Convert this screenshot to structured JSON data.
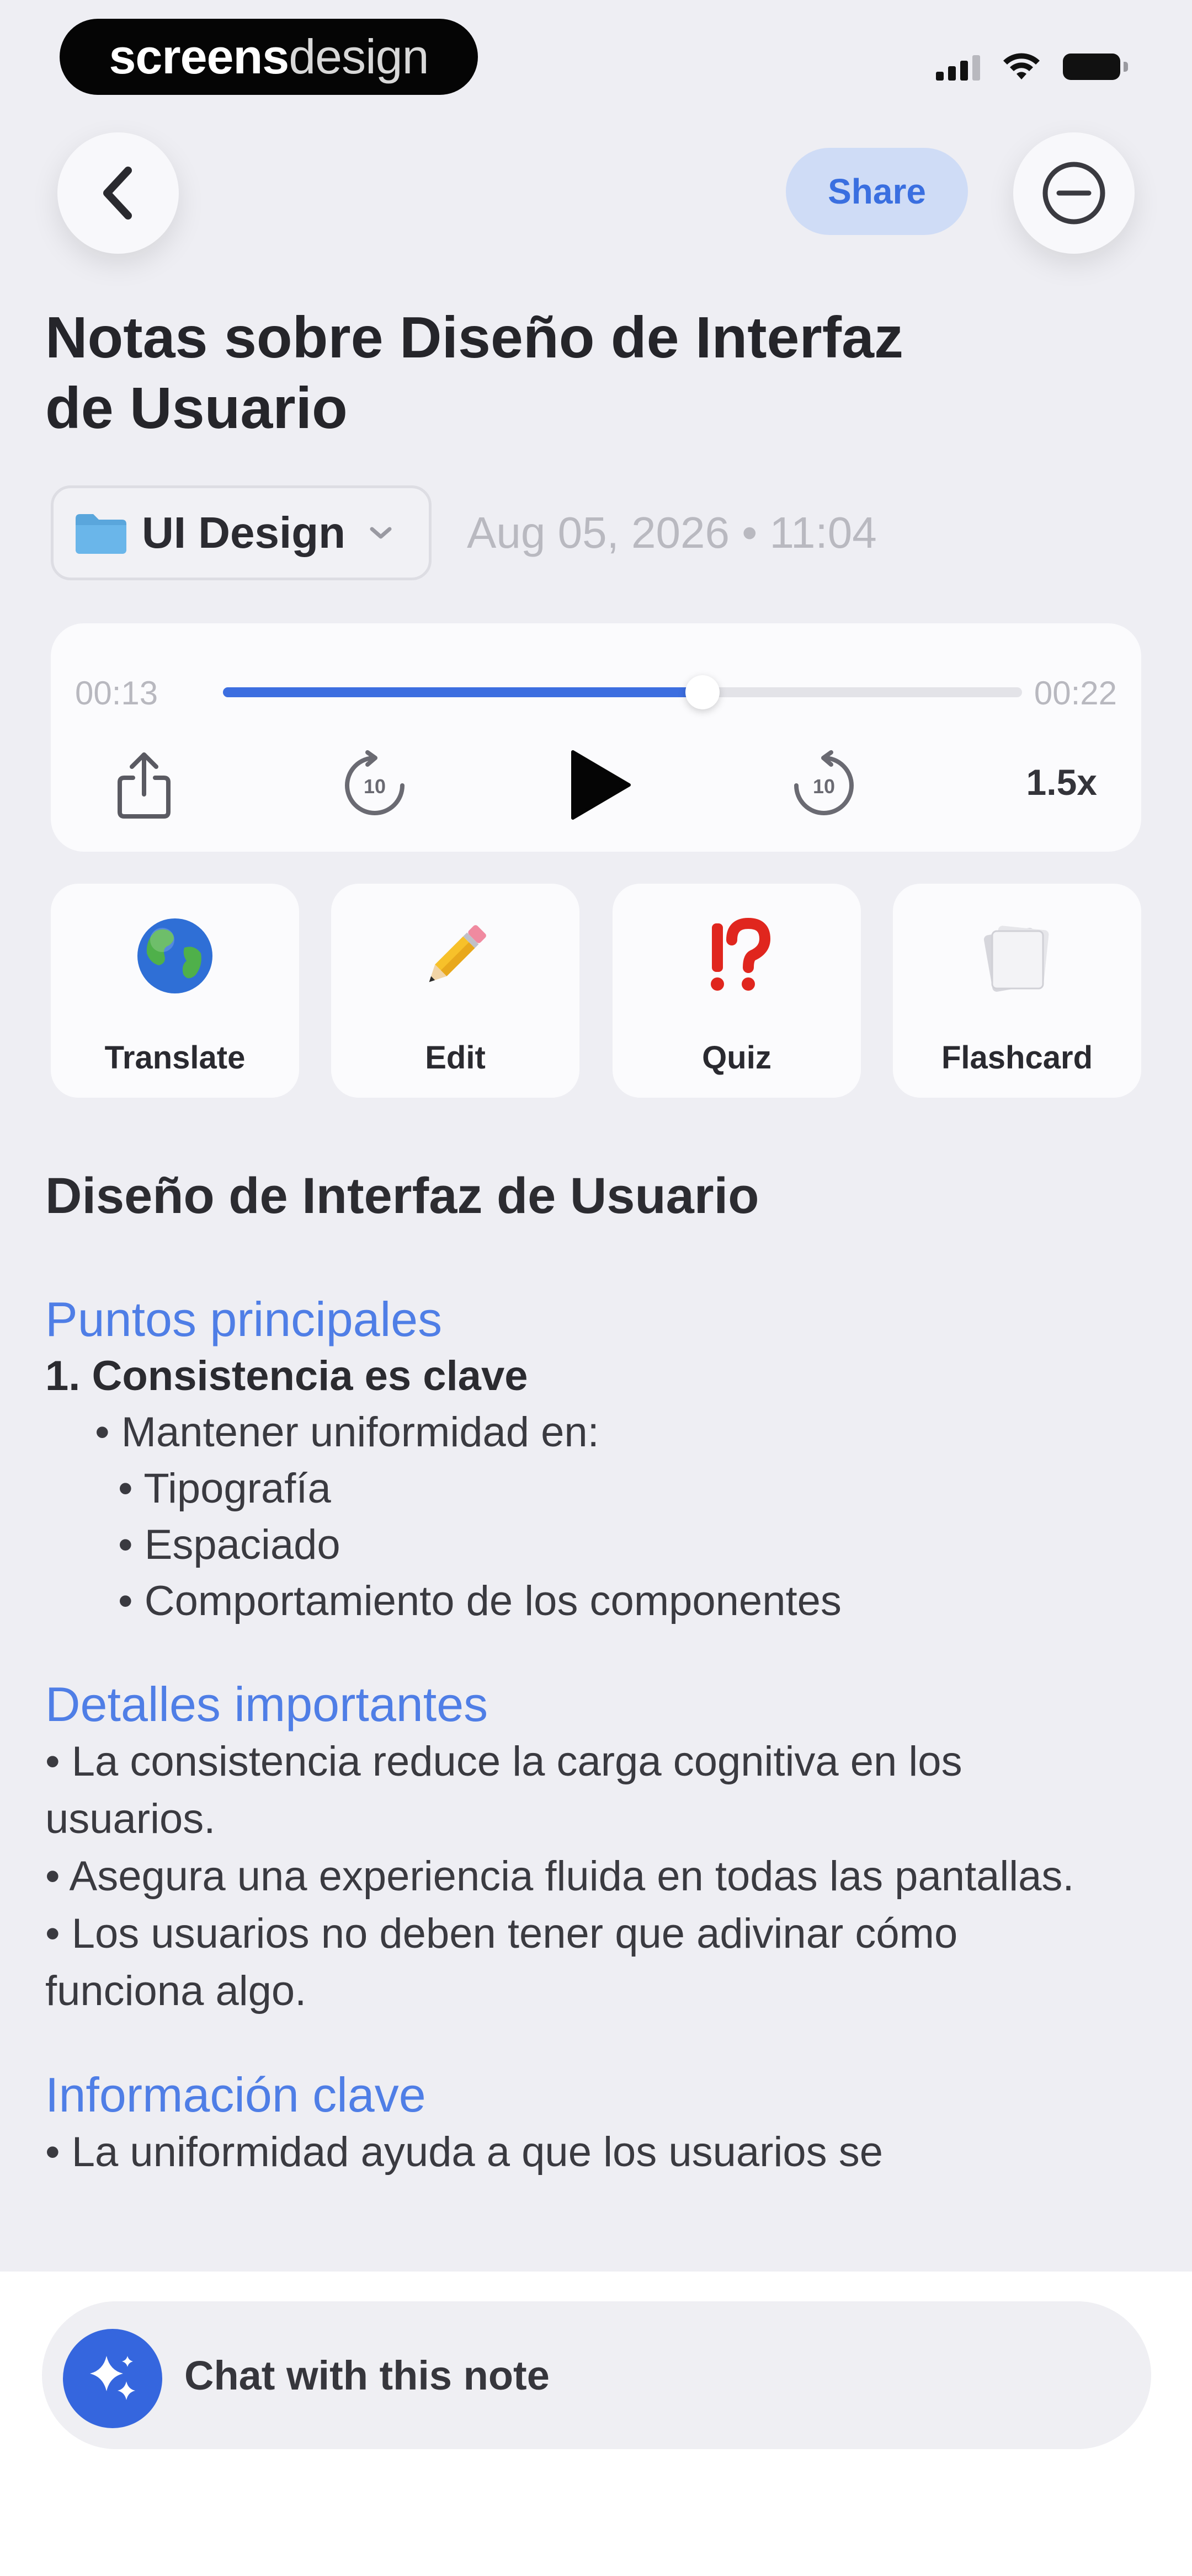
{
  "status_bar": {
    "brand_bold": "screens",
    "brand_light": "design"
  },
  "header": {
    "share_label": "Share",
    "title": "Notas sobre Diseño de Interfaz de Usuario"
  },
  "meta": {
    "folder_label": "UI Design",
    "date": "Aug 05, 2026 • 11:04"
  },
  "player": {
    "elapsed": "00:13",
    "total": "00:22",
    "progress": 0.6,
    "speed": "1.5x"
  },
  "actions": [
    {
      "label": "Translate",
      "icon": "globe-icon"
    },
    {
      "label": "Edit",
      "icon": "pencil-icon"
    },
    {
      "label": "Quiz",
      "icon": "interrobang-icon"
    },
    {
      "label": "Flashcard",
      "icon": "cards-icon"
    }
  ],
  "note": {
    "heading": "Diseño de Interfaz de Usuario",
    "sections": [
      {
        "title": "Puntos principales",
        "lines": [
          "1. Consistencia es clave",
          "• Mantener uniformidad en:",
          "• Tipografía",
          "• Espaciado",
          "• Comportamiento de los componentes"
        ]
      },
      {
        "title": "Detalles importantes",
        "lines": [
          "• La consistencia reduce la carga cognitiva en los usuarios.",
          "• Asegura una experiencia fluida en todas las pantallas.",
          "• Los usuarios no deben tener que adivinar cómo funciona algo."
        ]
      },
      {
        "title": "Información clave",
        "lines": [
          "• La uniformidad ayuda a que los usuarios se"
        ]
      }
    ]
  },
  "chat": {
    "label": "Chat with this note"
  },
  "colors": {
    "accent": "#3c6ee0",
    "section_heading": "#4f7ee6",
    "share_bg": "#cfdcf6",
    "background": "#eeeef3"
  }
}
